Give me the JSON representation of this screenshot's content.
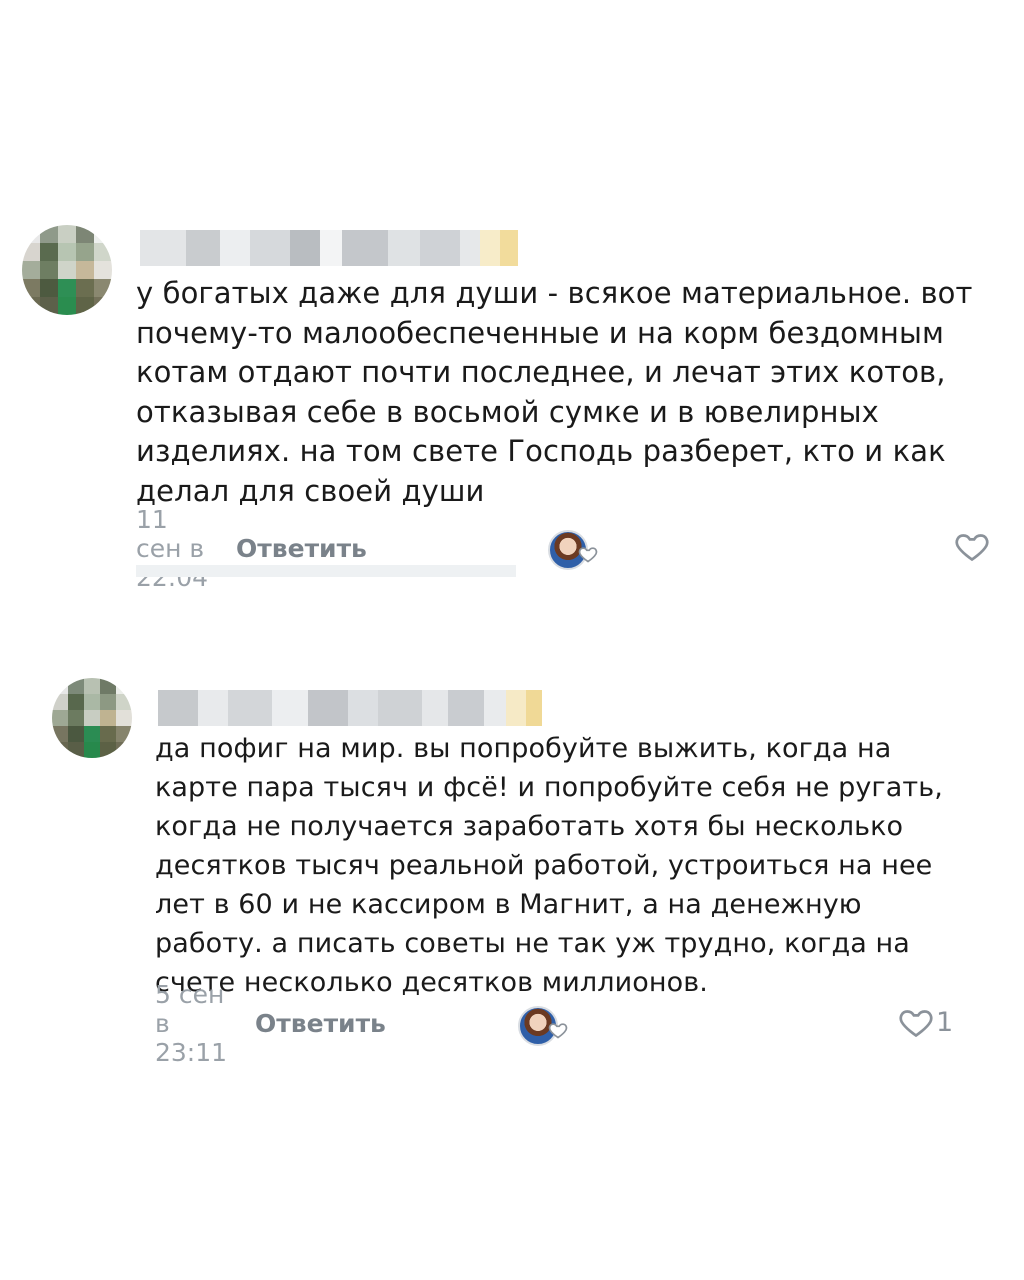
{
  "comments": [
    {
      "text": "у богатых даже для души - всякое материальное. вот почему-то малообеспеченные и на корм бездомным котам отдают почти последнее, и лечат этих котов, отказывая себе в восьмой сумке и в ювелирных изделиях. на том свете Господь разберет, кто и как делал для своей души",
      "date": "11 сен в 22:04",
      "reply_label": "Ответить",
      "like_count": ""
    },
    {
      "text": "да пофиг на мир. вы попробуйте выжить, когда на карте пара тысяч и фсё! и попробуйте себя не ругать, когда не получается заработать хотя бы несколько десятков тысяч реальной работой, устроиться на нее лет в 60 и не кассиром в Магнит, а на денежную работу. а писать советы не так уж трудно, когда на счете несколько десятков миллионов.",
      "date": "5 сен в 23:11",
      "reply_label": "Ответить",
      "like_count": "1"
    }
  ],
  "icons": {
    "like": "heart-outline-icon",
    "author_reaction": "author-avatar-heart-icon"
  },
  "colors": {
    "text": "#1a1a1a",
    "meta": "#9aa1a8",
    "icon": "#8b929a"
  }
}
